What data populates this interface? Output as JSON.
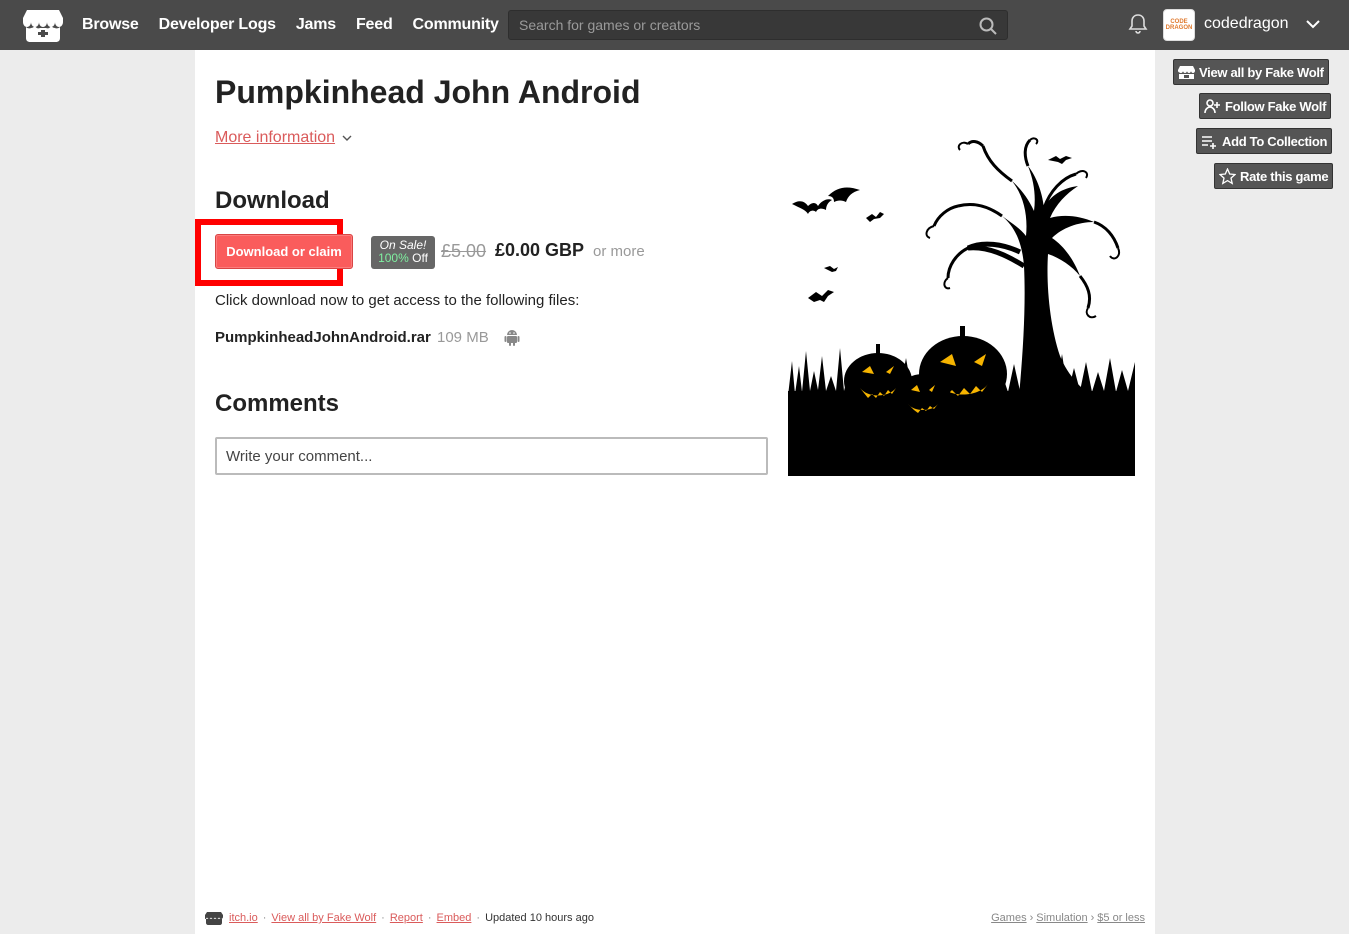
{
  "header": {
    "nav": [
      "Browse",
      "Developer Logs",
      "Jams",
      "Feed",
      "Community"
    ],
    "search_placeholder": "Search for games or creators",
    "username": "codedragon",
    "avatar_text": "CODE DRAGON"
  },
  "game": {
    "title": "Pumpkinhead John Android",
    "more_info": "More information",
    "download_heading": "Download",
    "download_button": "Download or claim",
    "sale_label": "On Sale!",
    "sale_percent": "100%",
    "sale_off": "Off",
    "price_old": "£5.00",
    "price_new": "£0.00 GBP",
    "or_more": "or more",
    "files_note": "Click download now to get access to the following files:",
    "file_name": "PumpkinheadJohnAndroid.rar",
    "file_size": "109 MB",
    "file_platform_icon": "android-icon",
    "comments_heading": "Comments",
    "comment_placeholder": "Write your comment..."
  },
  "sidebar": {
    "view_all": "View all by Fake Wolf",
    "follow": "Follow Fake Wolf",
    "add_collection": "Add To Collection",
    "rate": "Rate this game"
  },
  "footer": {
    "site": "itch.io",
    "view_all": "View all by Fake Wolf",
    "report": "Report",
    "embed": "Embed",
    "updated": "Updated 10 hours ago",
    "crumbs": [
      "Games",
      "Simulation",
      "$5 or less"
    ]
  },
  "colors": {
    "header_bg": "#4a4a4a",
    "accent": "#fa5c5c",
    "link": "#da5b5b",
    "highlight": "#ff0000"
  }
}
